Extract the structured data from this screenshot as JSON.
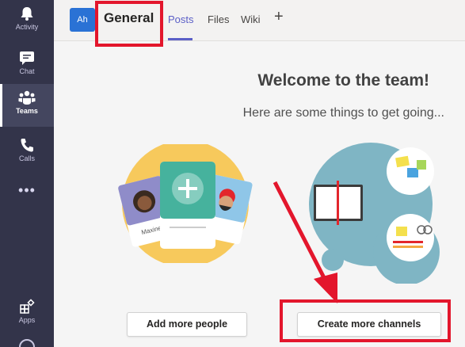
{
  "appbar": {
    "items": [
      {
        "label": "Activity",
        "icon": "bell-icon"
      },
      {
        "label": "Chat",
        "icon": "chat-icon"
      },
      {
        "label": "Teams",
        "icon": "teams-icon",
        "active": true
      },
      {
        "label": "Calls",
        "icon": "phone-icon"
      },
      {
        "label": "Apps",
        "icon": "apps-icon"
      }
    ],
    "more": "•••"
  },
  "header": {
    "team_avatar": "Ah",
    "channel": "General",
    "tabs": [
      {
        "label": "Posts",
        "active": true
      },
      {
        "label": "Files"
      },
      {
        "label": "Wiki"
      }
    ],
    "add_tab": "+"
  },
  "main": {
    "title": "Welcome to the team!",
    "subtitle": "Here are some things to get going...",
    "cards": {
      "left_name": "Maxine"
    },
    "buttons": {
      "add_people": "Add more people",
      "create_channels": "Create more channels"
    }
  },
  "colors": {
    "appbar": "#33344a",
    "accent": "#5b5fc7",
    "annotation": "#e3162c",
    "people_circle": "#f7c95c",
    "channels_circle": "#7fb5c4"
  }
}
